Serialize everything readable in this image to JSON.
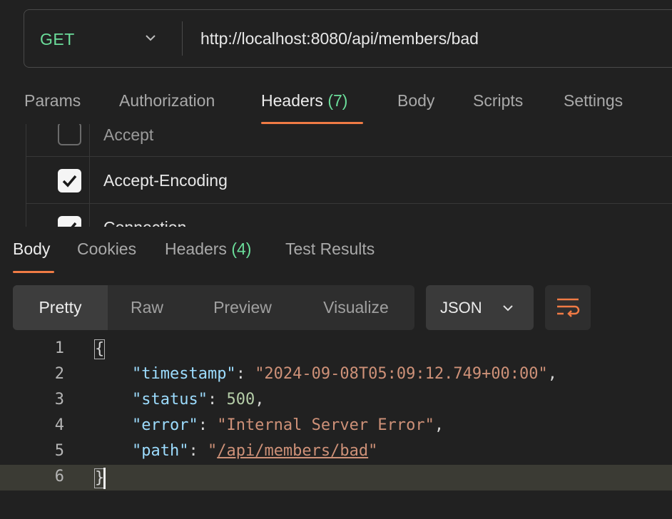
{
  "request": {
    "method": "GET",
    "url": "http://localhost:8080/api/members/bad"
  },
  "request_tabs": [
    {
      "label": "Params"
    },
    {
      "label": "Authorization"
    },
    {
      "label": "Headers",
      "count": "(7)"
    },
    {
      "label": "Body"
    },
    {
      "label": "Scripts"
    },
    {
      "label": "Settings"
    }
  ],
  "headers_rows": [
    {
      "label": "Accept",
      "checked": false
    },
    {
      "label": "Accept-Encoding",
      "checked": true
    },
    {
      "label": "Connection",
      "checked": true
    }
  ],
  "response_tabs": [
    {
      "label": "Body"
    },
    {
      "label": "Cookies"
    },
    {
      "label": "Headers",
      "count": "(4)"
    },
    {
      "label": "Test Results"
    }
  ],
  "view_modes": [
    "Pretty",
    "Raw",
    "Preview",
    "Visualize"
  ],
  "format": "JSON",
  "response_body": {
    "line_numbers": [
      "1",
      "2",
      "3",
      "4",
      "5",
      "6"
    ],
    "open_brace": "{",
    "close_brace": "}",
    "k_timestamp": "\"timestamp\"",
    "v_timestamp": "\"2024-09-08T05:09:12.749+00:00\"",
    "k_status": "\"status\"",
    "v_status": "500",
    "k_error": "\"error\"",
    "v_error": "\"Internal Server Error\"",
    "k_path": "\"path\"",
    "v_path_open": "\"",
    "v_path_link": "/api/members/bad",
    "v_path_close": "\""
  },
  "colors": {
    "accent": "#f07b45",
    "method": "#6bdd9a",
    "background": "#212121"
  }
}
